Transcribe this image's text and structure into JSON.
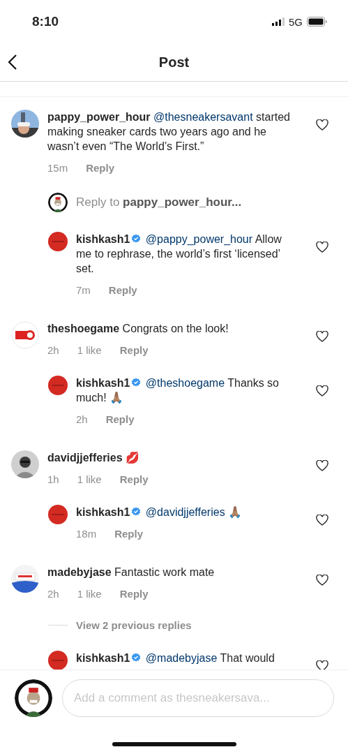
{
  "status_bar": {
    "time": "8:10",
    "network": "5G"
  },
  "header": {
    "title": "Post"
  },
  "comments": [
    {
      "username": "pappy_power_hour",
      "verified": false,
      "mention": "@thesneakersavant",
      "text": "started making sneaker cards two years ago and he wasn’t even “The World’s First.”",
      "time": "15m",
      "reply": "Reply",
      "reply_prompt": {
        "prefix": "Reply to",
        "user": "pappy_power_hour..."
      },
      "children": [
        {
          "username": "kishkash1",
          "verified": true,
          "mention": "@pappy_power_hour",
          "text": "Allow me to rephrase, the world’s first ‘licensed’ set.",
          "time": "7m",
          "reply": "Reply"
        }
      ]
    },
    {
      "username": "theshoegame",
      "verified": false,
      "text": "Congrats on the look!",
      "time": "2h",
      "likes": "1 like",
      "reply": "Reply",
      "children": [
        {
          "username": "kishkash1",
          "verified": true,
          "mention": "@theshoegame",
          "text": "Thanks so much! 🙏🏽",
          "time": "2h",
          "reply": "Reply"
        }
      ]
    },
    {
      "username": "davidjjefferies",
      "verified": false,
      "text": "💋",
      "time": "1h",
      "likes": "1 like",
      "reply": "Reply",
      "children": [
        {
          "username": "kishkash1",
          "verified": true,
          "mention": "@davidjjefferies",
          "text": "🙏🏽",
          "time": "18m",
          "reply": "Reply"
        }
      ]
    },
    {
      "username": "madebyjase",
      "verified": false,
      "text": "Fantastic work mate",
      "time": "2h",
      "likes": "1 like",
      "reply": "Reply",
      "view_replies": "View 2 previous replies",
      "children": [
        {
          "username": "kishkash1",
          "verified": true,
          "mention": "@madebyjase",
          "text": "That would"
        }
      ]
    }
  ],
  "composer": {
    "placeholder": "Add a comment as thesneakersava..."
  }
}
